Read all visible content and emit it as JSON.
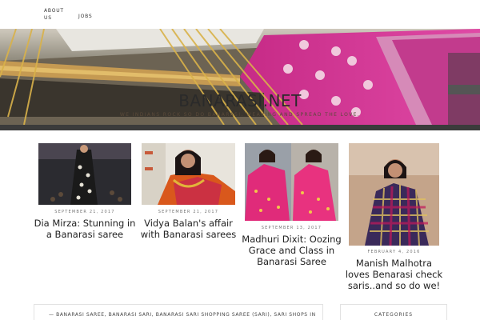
{
  "nav": {
    "items": [
      {
        "label": "ABOUT US"
      },
      {
        "label": "JOBS"
      }
    ]
  },
  "site": {
    "title": "BANARASI.NET",
    "tagline": "WE INDIANS ROCK SO DO BANARASI. WEAVING AND SPREAD THE LOVE."
  },
  "posts": [
    {
      "date": "SEPTEMBER 21, 2017",
      "title": "Dia Mirza: Stunning in a Banarasi saree"
    },
    {
      "date": "SEPTEMBER 21, 2017",
      "title": "Vidya Balan's affair with Banarasi sarees"
    },
    {
      "date": "SEPTEMBER 13, 2017",
      "title": "Madhuri Dixit: Oozing Grace and Class in Banarasi Saree"
    },
    {
      "date": "FEBRUARY 4, 2016",
      "title": "Manish Malhotra loves Benarasi check saris..and so do we!"
    }
  ],
  "tags": {
    "text": "— BANARASI SAREE, BANARASI SARI, BANARASI SARI SHOPPING SAREE (SARI), SARI SHOPS IN"
  },
  "sidebar": {
    "categories_heading": "CATEGORIES"
  }
}
